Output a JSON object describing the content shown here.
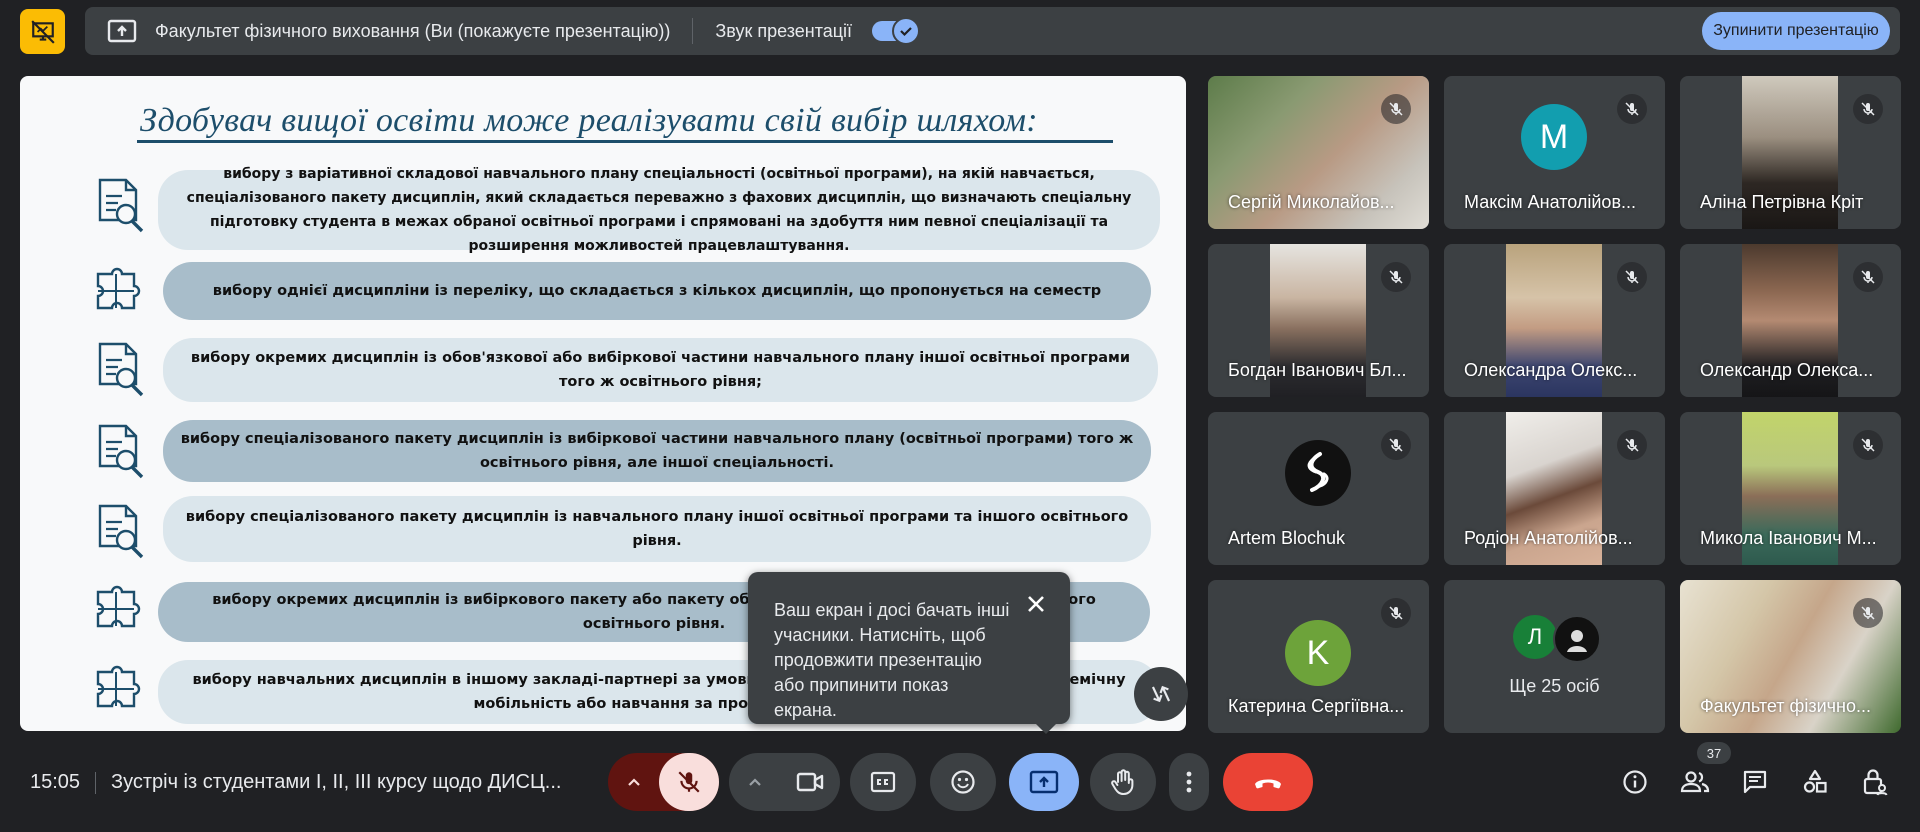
{
  "topbar": {
    "presenting_title": "Факультет фізичного виховання (Ви (покажуєте презентацію))",
    "sound_label": "Звук презентації",
    "stop_button": "Зупинити презентацію"
  },
  "slide": {
    "title": "Здобувач вищої освіти може реалізувати свій вибір шляхом:",
    "items": [
      "вибору з варіативної складової навчального плану спеціальності (освітньої програми), на якій навчається, спеціалізованого пакету дисциплін, який складається переважно з фахових дисциплін, що визначають спеціальну підготовку студента в межах обраної освітньої програми і спрямовані на здобуття ним певної спеціалізації та розширення можливостей працевлаштування.",
      "вибору однієї дисципліни із переліку, що складається з кількох дисциплін, що пропонується на семестр",
      "вибору окремих дисциплін із обов'язкової або вибіркової частини навчального плану іншої освітньої програми того ж освітнього рівня;",
      "вибору спеціалізованого пакету дисциплін із вибіркової частини навчального плану (освітньої програми) того ж освітнього рівня, але іншої спеціальності.",
      "вибору спеціалізованого пакету дисциплін із навчального плану іншої освітньої програми та іншого освітнього рівня.",
      "вибору окремих дисциплін із вибіркового пакету або пакету обов'язко                                              ншого освітнього рівня.",
      "вибору навчальних дисциплін в іншому закладі-партнері за умови реаліз                                              адемічну мобільність або навчання за програмами по"
    ]
  },
  "tooltip": {
    "text": "Ваш екран і досі бачать інші учасники. Натисніть, щоб продовжити презентацію або припинити показ екрана."
  },
  "participants": [
    {
      "name": "Сергій Миколайов...",
      "type": "video"
    },
    {
      "name": "Максім Анатолійов...",
      "type": "avatar",
      "initial": "M",
      "color": "#129eaf"
    },
    {
      "name": "Аліна Петрівна Кріт",
      "type": "video"
    },
    {
      "name": "Богдан Іванович Бл...",
      "type": "video"
    },
    {
      "name": "Олександра Олекс...",
      "type": "video"
    },
    {
      "name": "Олександр Олекса...",
      "type": "video"
    },
    {
      "name": "Artem Blochuk",
      "type": "avatar-logo"
    },
    {
      "name": "Родіон Анатолійов...",
      "type": "video"
    },
    {
      "name": "Микола Іванович М...",
      "type": "video"
    },
    {
      "name": "Катерина Сергіївна...",
      "type": "avatar",
      "initial": "K",
      "color": "#6da33a"
    },
    {
      "name": "Ще 25 осіб",
      "type": "more",
      "initial": "Л"
    },
    {
      "name": "Факультет фізично...",
      "type": "video"
    }
  ],
  "bottombar": {
    "time": "15:05",
    "meeting_title": "Зустріч із студентами І, ІІ, ІІІ курсу щодо ДИСЦ...",
    "participant_count": "37"
  },
  "colors": {
    "accent": "#8ab4f8",
    "end_call": "#ea4335",
    "mic_off_bg": "#f9dedc",
    "presenting_yellow": "#fbbc04"
  }
}
